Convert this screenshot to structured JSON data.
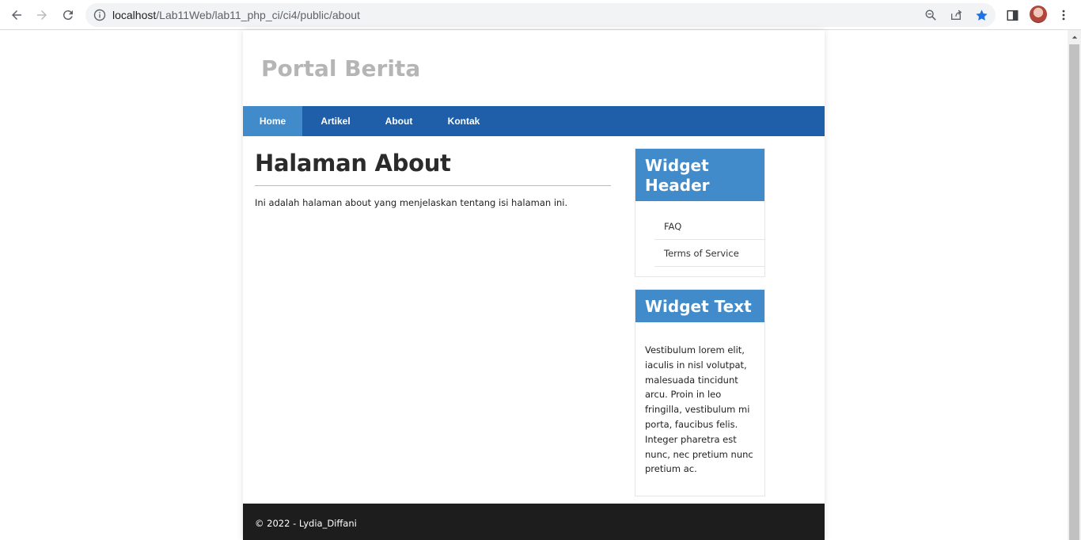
{
  "browser": {
    "url_host": "localhost",
    "url_path": "/Lab11Web/lab11_php_ci/ci4/public/about",
    "bookmark_color": "#1a73e8",
    "icons": [
      "back-icon",
      "forward-icon",
      "reload-icon",
      "info-icon",
      "zoom-icon",
      "share-icon",
      "star-icon",
      "side-panel-icon",
      "profile-avatar",
      "kebab-menu-icon"
    ]
  },
  "site": {
    "title": "Portal Berita",
    "nav": [
      {
        "label": "Home",
        "active": true
      },
      {
        "label": "Artikel",
        "active": false
      },
      {
        "label": "About",
        "active": false
      },
      {
        "label": "Kontak",
        "active": false
      }
    ]
  },
  "main": {
    "heading": "Halaman About",
    "body": "Ini adalah halaman about yang menjelaskan tentang isi halaman ini."
  },
  "sidebar": {
    "widget_links": {
      "header": "Widget Header",
      "links": [
        {
          "label": "FAQ"
        },
        {
          "label": "Terms of Service"
        }
      ]
    },
    "widget_text": {
      "header": "Widget Text",
      "body": "Vestibulum lorem elit, iaculis in nisl volutpat, malesuada tincidunt arcu. Proin in leo fringilla, vestibulum mi porta, faucibus felis. Integer pharetra est nunc, nec pretium nunc pretium ac."
    }
  },
  "footer": {
    "text": "© 2022 - Lydia_Diffani"
  },
  "colors": {
    "navbar": "#1f5faa",
    "nav_active": "#428bca",
    "widget_header": "#428bca",
    "footer": "#1d1d1d",
    "site_title": "#b5b5b5"
  }
}
